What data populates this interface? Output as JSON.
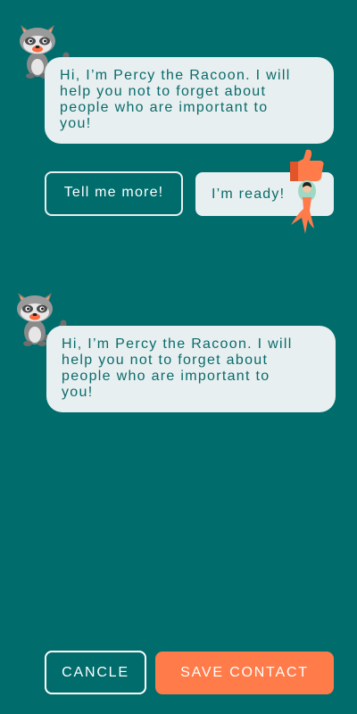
{
  "conversation": [
    {
      "speaker": "raccoon",
      "lines": [
        "Hi, I’m Percy the Racoon. I will",
        "help you not to forget about",
        "people who are important to",
        "you!"
      ]
    },
    {
      "speaker": "raccoon",
      "lines": [
        "Hi, I’m Percy the Racoon. I will",
        "help you not to forget about",
        "people who are important to",
        "you!"
      ]
    }
  ],
  "quick_replies": {
    "tell_more": "Tell me more!",
    "ready": "I’m ready!"
  },
  "footer": {
    "cancel_label": "CANCLE",
    "save_label": "SAVE CONTACT"
  },
  "colors": {
    "background": "#006c6c",
    "bubble": "#e8eff0",
    "bubble_text": "#0a6b6b",
    "accent": "#ff7b4a"
  },
  "icons": {
    "mascot": "raccoon-mascot-icon",
    "sticker": "thumbs-up-sticker-icon"
  }
}
